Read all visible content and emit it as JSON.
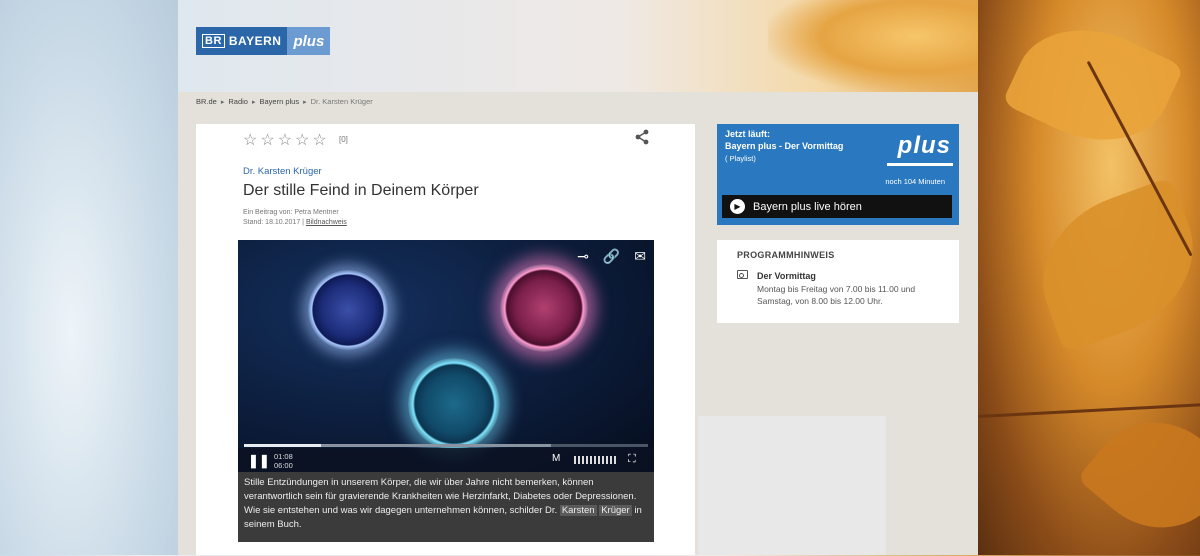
{
  "logo": {
    "br": "BR",
    "brand": "BAYERN",
    "plus": "plus"
  },
  "breadcrumb": [
    "BR.de",
    "Radio",
    "Bayern plus",
    "Dr. Karsten Krüger"
  ],
  "article": {
    "stars": [
      "☆",
      "☆",
      "☆",
      "☆",
      "☆"
    ],
    "rating_count": "[0]",
    "author": "Dr. Karsten Krüger",
    "title": "Der stille Feind in Deinem Körper",
    "byline": "Ein Beitrag von: Petra Mentner",
    "date": "Stand: 18.10.2017",
    "separator": "|",
    "image_credit": "Bildnachweis",
    "caption_prefix": "Stille Entzündungen in unserem Körper, die wir über Jahre nicht bemerken, können verantwortlich sein für gravierende Krankheiten wie Herzinfarkt, Diabetes oder Depressionen. Wie sie entstehen und was wir dagegen unternehmen können, schilder Dr.",
    "caption_hl1": "Karsten",
    "caption_hl2": "Krüger",
    "caption_suffix": " in seinem Buch."
  },
  "player": {
    "current_time": "01:08",
    "duration": "06:00",
    "progress": 0.19,
    "buffered": 0.76,
    "mute_label": "M",
    "volume": 1.0
  },
  "now_playing": {
    "label": "Jetzt läuft:",
    "show": "Bayern plus - Der Vormittag",
    "playlist": "( Playlist)",
    "logo_text": "plus",
    "remaining": "noch 104 Minuten",
    "listen_label": "Bayern plus live hören"
  },
  "program": {
    "heading": "PROGRAMMHINWEIS",
    "title": "Der Vormittag",
    "description": "Montag bis Freitag von 7.00 bis 11.00 und Samstag, von 8.00 bis 12.00 Uhr."
  },
  "colors": {
    "brand_blue": "#2a78c0",
    "link_blue": "#2a66a8"
  }
}
